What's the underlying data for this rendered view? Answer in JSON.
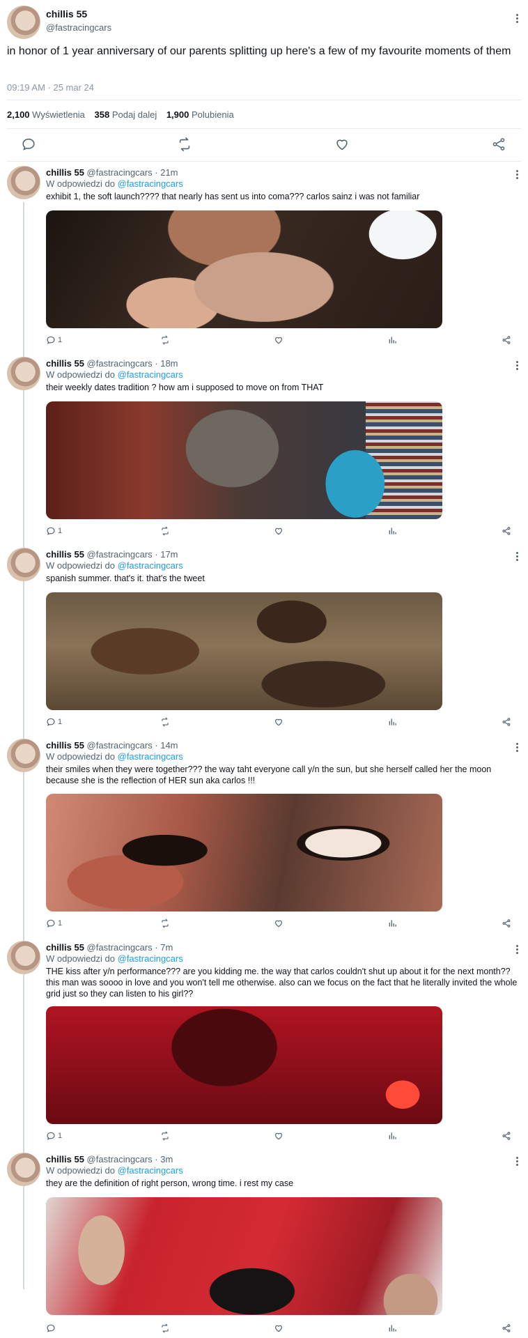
{
  "main_tweet": {
    "name": "chillis 55",
    "handle": "@fastracingcars",
    "text": "in honor of 1 year anniversary of our parents splitting up here's a few of my favourite moments of them",
    "time": "09:19 AM · 25 mar 24",
    "stats": {
      "views_count": "2,100",
      "views_label": "Wyświetlenia",
      "retweets_count": "358",
      "retweets_label": "Podaj dalej",
      "likes_count": "1,900",
      "likes_label": "Polubienia"
    }
  },
  "replies": [
    {
      "name": "chillis 55",
      "handle_time": "@fastracingcars · 21m",
      "reply_prefix": "W odpowiedzi do",
      "reply_to": "@fastracingcars",
      "text": "exhibit 1, the soft launch???? that nearly has sent us into coma??? carlos sainz i was not familiar",
      "reply_count": "1"
    },
    {
      "name": "chillis 55",
      "handle_time": "@fastracingcars · 18m",
      "reply_prefix": "W odpowiedzi do",
      "reply_to": "@fastracingcars",
      "text": "their weekly dates tradition ? how am i supposed to move on from THAT",
      "reply_count": "1"
    },
    {
      "name": "chillis 55",
      "handle_time": "@fastracingcars · 17m",
      "reply_prefix": "W odpowiedzi do",
      "reply_to": "@fastracingcars",
      "text": "spanish summer. that's it. that's the tweet",
      "reply_count": "1"
    },
    {
      "name": "chillis 55",
      "handle_time": "@fastracingcars · 14m",
      "reply_prefix": "W odpowiedzi do",
      "reply_to": "@fastracingcars",
      "text": "their smiles when they were together??? the way taht everyone call y/n the sun, but she herself called her the moon because she is the reflection of HER sun aka carlos !!!",
      "reply_count": "1"
    },
    {
      "name": "chillis 55",
      "handle_time": "@fastracingcars · 7m",
      "reply_prefix": "W odpowiedzi do",
      "reply_to": "@fastracingcars",
      "text": "THE kiss after y/n performance??? are you kidding me. the way that carlos couldn't shut up about it for the next month?? this man was soooo in love and you won't tell me otherwise. also can we focus on the fact that he literally invited the whole grid just so they can listen to his girl??",
      "reply_count": "1"
    },
    {
      "name": "chillis 55",
      "handle_time": "@fastracingcars · 3m",
      "reply_prefix": "W odpowiedzi do",
      "reply_to": "@fastracingcars",
      "text": "they are the definition of right person, wrong time. i rest my case",
      "reply_count": ""
    }
  ]
}
